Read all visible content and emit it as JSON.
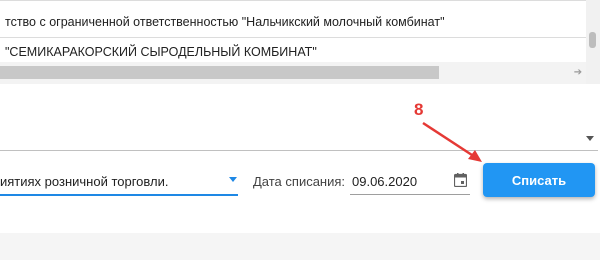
{
  "list": {
    "rows": [
      "тство с ограниченной ответственностью \"Нальчикский молочный комбинат\"",
      "\"СЕМИКАРАКОРСКИЙ СЫРОДЕЛЬНЫЙ КОМБИНАТ\""
    ],
    "scroll_right_glyph": "➔"
  },
  "form": {
    "reason_value": "иятиях розничной торговли.",
    "date_label": "Дата списания:",
    "date_value": "09.06.2020",
    "submit_label": "Списать"
  },
  "annotation": {
    "number": "8",
    "color": "#e53935"
  },
  "colors": {
    "accent": "#2196f3",
    "focus_underline": "#1e88e5"
  },
  "icons": {
    "calendar": "calendar-icon",
    "dropdown": "chevron-down-icon"
  }
}
